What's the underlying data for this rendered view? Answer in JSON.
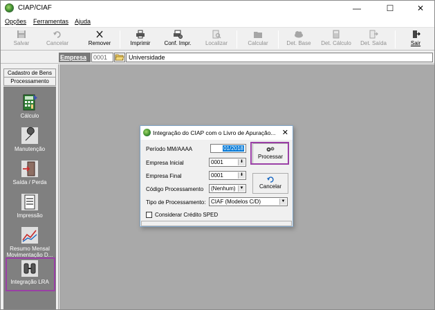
{
  "window": {
    "title": "CIAP/CIAF"
  },
  "menu": [
    {
      "label": "Opções"
    },
    {
      "label": "Ferramentas"
    },
    {
      "label": "Ajuda"
    }
  ],
  "toolbar": {
    "salvar": "Salvar",
    "cancelar": "Cancelar",
    "remover": "Remover",
    "imprimir": "Imprimir",
    "conf_impr": "Conf. Impr.",
    "localizar": "Localizar",
    "calcular": "Calcular",
    "det_base": "Det. Base",
    "det_calculo": "Det. Cálculo",
    "det_saida": "Det. Saída",
    "sair": "Sair"
  },
  "empresa": {
    "label": "Empresa",
    "code": "0001",
    "name": "Universidade"
  },
  "sidebar": {
    "tabs": [
      "Cadastro de Bens",
      "Processamento"
    ],
    "items": [
      {
        "label": "Cálculo"
      },
      {
        "label": "Manutenção"
      },
      {
        "label": "Saída / Perda"
      },
      {
        "label": "Impressão"
      },
      {
        "label": "Resumo Mensal Movimentação D..."
      },
      {
        "label": "Integração LRA"
      }
    ]
  },
  "dialog": {
    "title": "Integração do CIAP com o Livro de Apuração...",
    "periodo_label": "Período  MM/AAAA",
    "periodo_value": "01/2018",
    "empresa_inicial_label": "Empresa Inicial",
    "empresa_inicial_value": "0001",
    "empresa_final_label": "Empresa Final",
    "empresa_final_value": "0001",
    "codigo_label": "Código Processamento",
    "codigo_value": "(Nenhum)",
    "tipo_label": "Tipo de Processamento:",
    "tipo_value": "CIAF (Modelos C/D)",
    "checkbox_label": "Considerar Crédito SPED",
    "processar": "Processar",
    "cancelar": "Cancelar"
  },
  "colors": {
    "highlight": "#9a3fa6",
    "selection": "#0078d7",
    "main_bg": "#a9a9a9",
    "sidebar_bg": "#808080"
  }
}
